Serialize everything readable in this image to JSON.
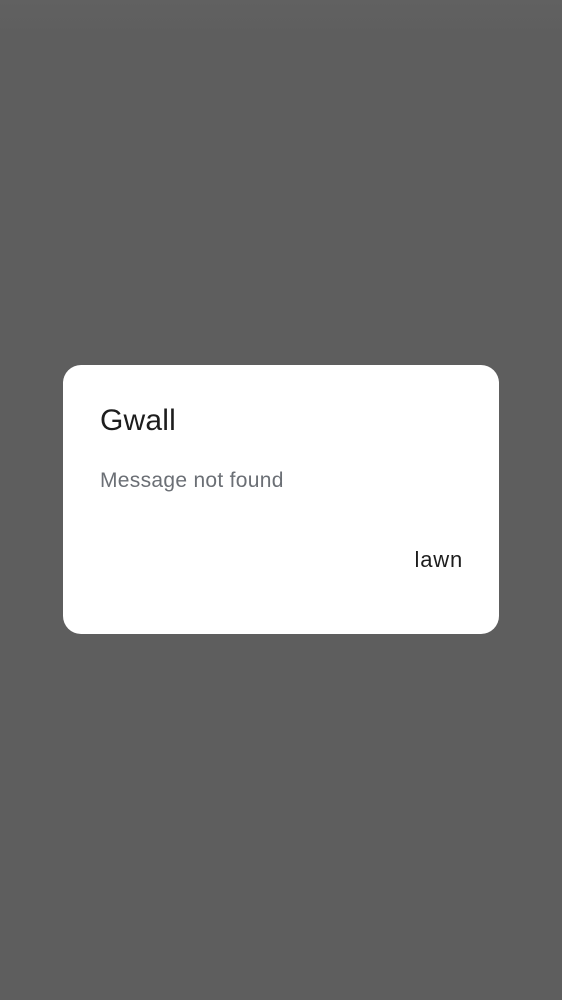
{
  "dialog": {
    "title": "Gwall",
    "message": "Message not found",
    "button_label": "lawn"
  },
  "colors": {
    "scrim": "#5e5e5e",
    "dialog_background": "#ffffff",
    "title_text": "#1d1d1d",
    "message_text": "#6b6f75"
  }
}
